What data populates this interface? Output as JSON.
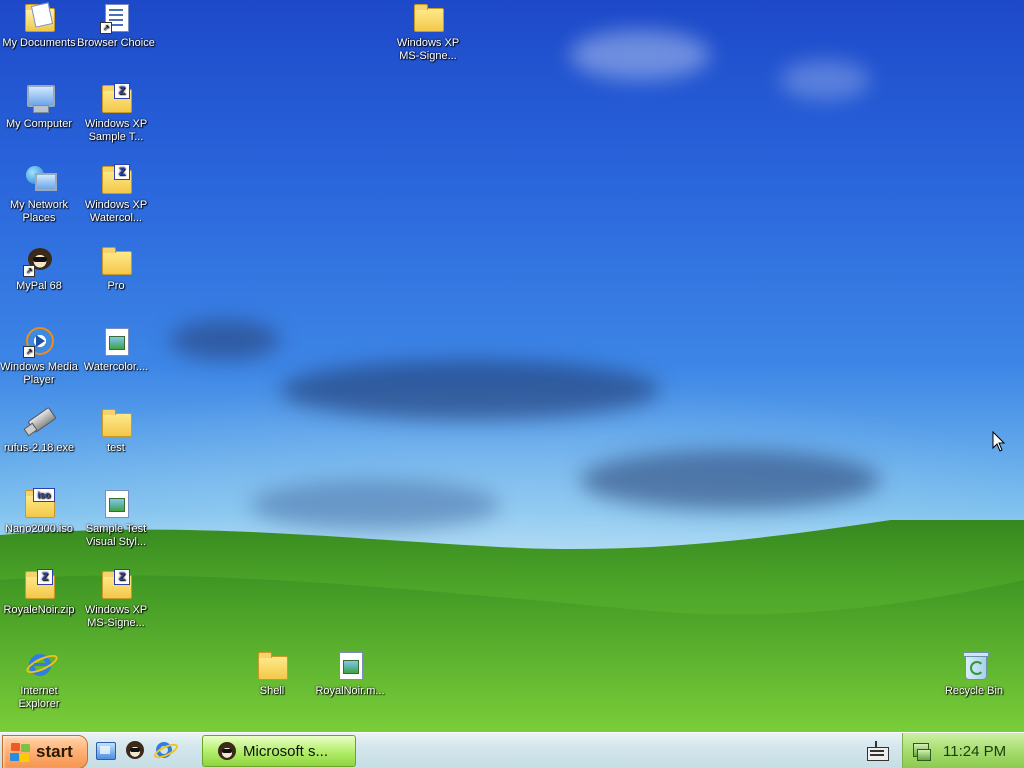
{
  "desktop": {
    "icons": [
      {
        "label": "My Documents",
        "type": "my-documents"
      },
      {
        "label": "Browser Choice",
        "type": "document-shortcut"
      },
      {
        "label": "Windows XP MS-Signe...",
        "type": "folder"
      },
      {
        "label": "My Computer",
        "type": "my-computer"
      },
      {
        "label": "Windows XP Sample T...",
        "type": "zip-folder"
      },
      {
        "label": "My Network Places",
        "type": "network"
      },
      {
        "label": "Windows XP Watercol...",
        "type": "zip-folder"
      },
      {
        "label": "MyPal 68",
        "type": "app-shortcut"
      },
      {
        "label": "Pro",
        "type": "folder"
      },
      {
        "label": "Windows Media Player",
        "type": "media-player"
      },
      {
        "label": "Watercolor....",
        "type": "image-file"
      },
      {
        "label": "rufus-2.18.exe",
        "type": "usb-exe"
      },
      {
        "label": "test",
        "type": "folder"
      },
      {
        "label": "Nano2000.iso",
        "type": "iso"
      },
      {
        "label": "Sample Test Visual Styl...",
        "type": "image-file"
      },
      {
        "label": "RoyaleNoir.zip",
        "type": "zip-folder"
      },
      {
        "label": "Windows XP MS-Signe...",
        "type": "zip-folder"
      },
      {
        "label": "Internet Explorer",
        "type": "ie"
      },
      {
        "label": "Shell",
        "type": "folder"
      },
      {
        "label": "RoyalNoir.m...",
        "type": "image-file"
      },
      {
        "label": "Recycle Bin",
        "type": "recycle-bin"
      }
    ]
  },
  "taskbar": {
    "start_label": "start",
    "quick_launch": [
      "show-desktop-icon",
      "mypal-icon",
      "internet-explorer-icon"
    ],
    "task": {
      "label": "Microsoft s..."
    },
    "tray": {
      "clock": "11:24 PM"
    }
  },
  "colors": {
    "sky_top": "#1d49c9",
    "grass": "#4fa82a",
    "start_orange": "#f4954f",
    "task_green": "#8ed43f"
  }
}
